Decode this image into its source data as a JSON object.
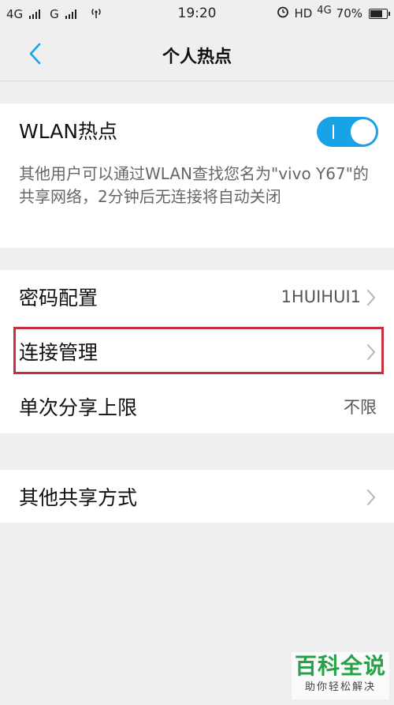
{
  "status_bar": {
    "sim1": "4G",
    "sim2": "G",
    "time": "19:20",
    "hd": "HD",
    "network": "4G",
    "battery": "70%"
  },
  "nav": {
    "title": "个人热点"
  },
  "hotspot": {
    "label": "WLAN热点",
    "enabled": true,
    "description": "其他用户可以通过WLAN查找您名为\"vivo Y67\"的共享网络，2分钟后无连接将自动关闭"
  },
  "settings": {
    "password_label": "密码配置",
    "password_value": "1HUIHUI1",
    "connection_label": "连接管理",
    "share_limit_label": "单次分享上限",
    "share_limit_value": "不限"
  },
  "other": {
    "label": "其他共享方式"
  },
  "watermark": {
    "title": "百科全说",
    "subtitle": "助你轻松解决"
  },
  "colors": {
    "accent": "#1aa2e6",
    "highlight": "#c7303d",
    "watermark": "#27a149"
  }
}
